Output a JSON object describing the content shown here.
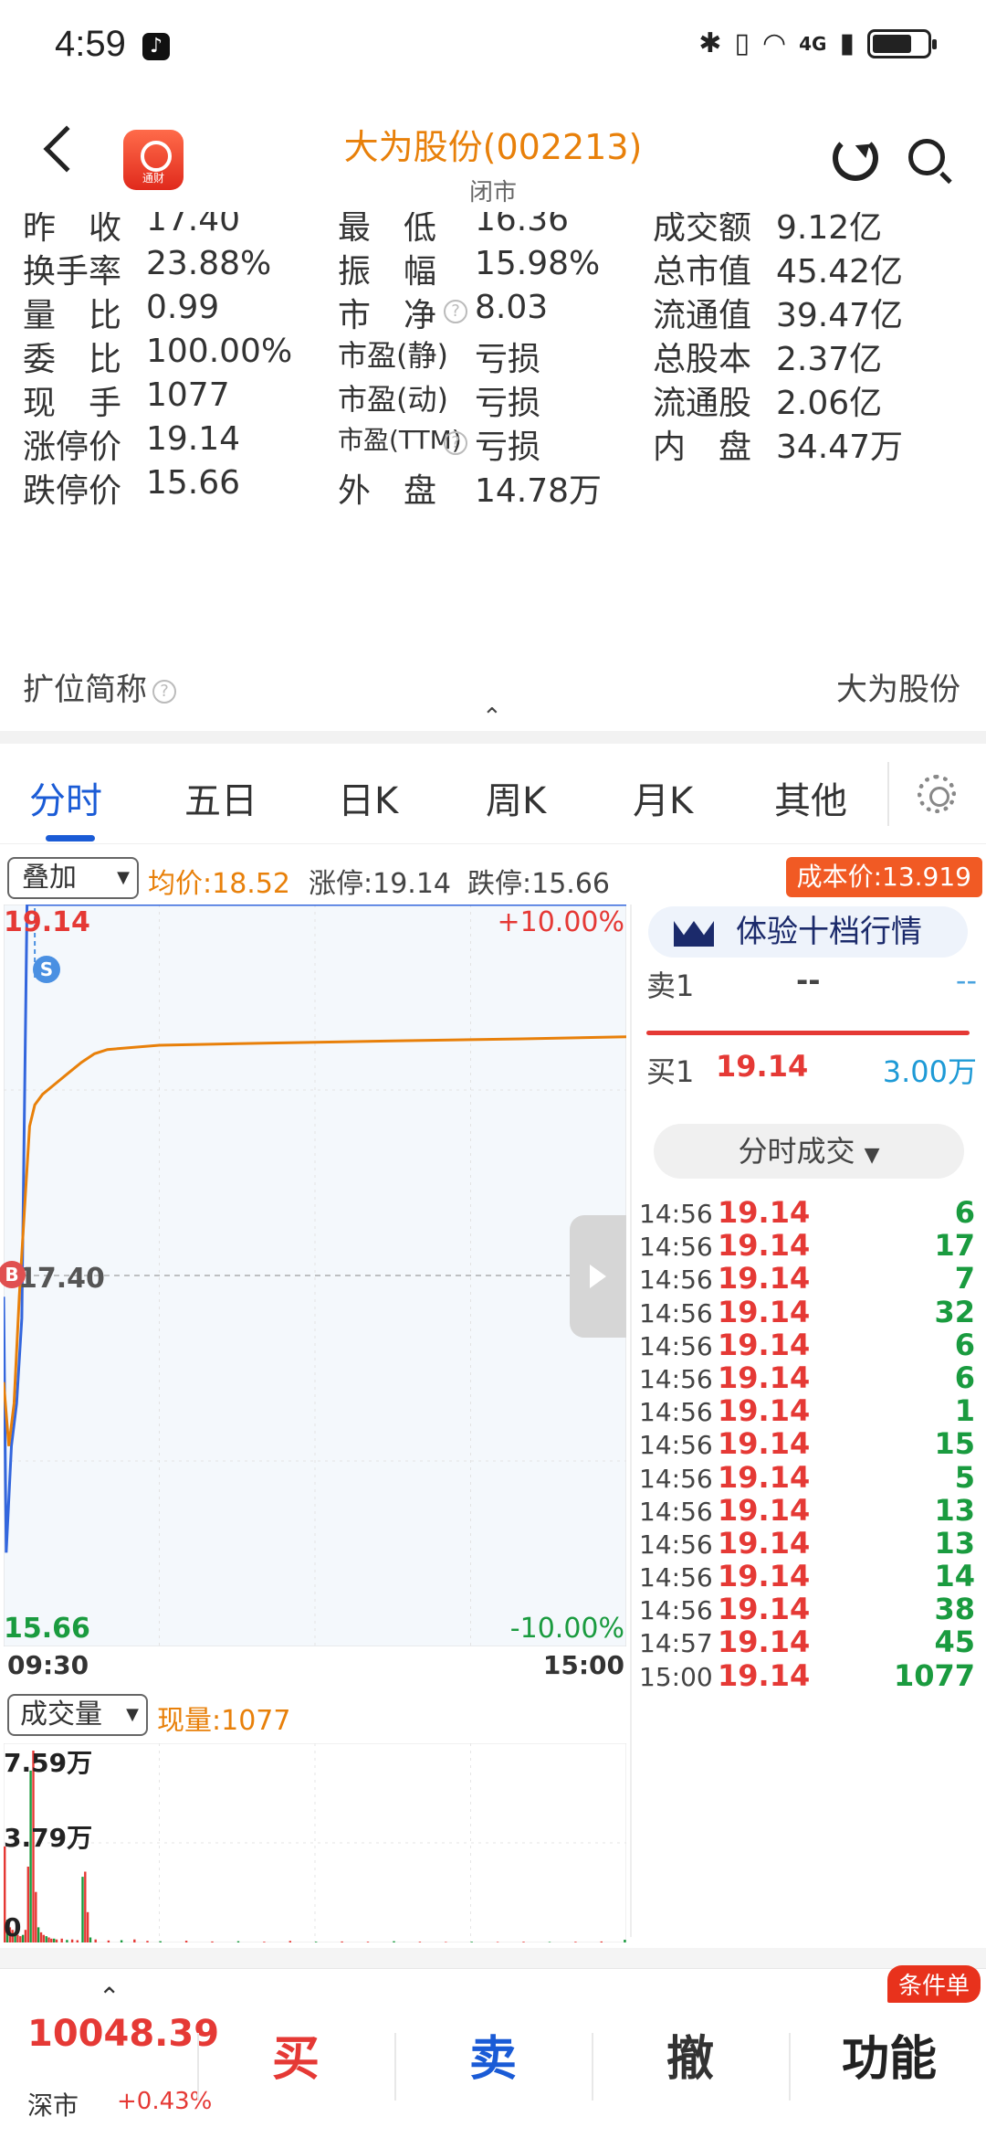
{
  "status_bar": {
    "time": "4:59",
    "network": "4G"
  },
  "header": {
    "title": "大为股份(002213)",
    "subtitle": "闭市",
    "app_logo_text": "通财"
  },
  "quote": {
    "rows": [
      [
        {
          "label": "昨　收",
          "value": "17.40",
          "color": "#333333"
        },
        {
          "label": "最　低",
          "value": "16.36",
          "color": "#333333"
        },
        {
          "label": "成交额",
          "value": "9.12亿",
          "color": "#333333"
        }
      ],
      [
        {
          "label": "换手率",
          "value": "23.88%",
          "color": "#333333"
        },
        {
          "label": "振　幅",
          "value": "15.98%",
          "color": "#333333"
        },
        {
          "label": "总市值",
          "value": "45.42亿",
          "color": "#333333"
        }
      ],
      [
        {
          "label": "量　比",
          "value": "0.99",
          "color": "#333333"
        },
        {
          "label": "市　净",
          "value": "8.03",
          "color": "#333333"
        },
        {
          "label": "流通值",
          "value": "39.47亿",
          "color": "#333333"
        }
      ],
      [
        {
          "label": "委　比",
          "value": "100.00%",
          "color": "#333333"
        },
        {
          "label": "市盈(静)",
          "value": "亏损",
          "color": "#333333"
        },
        {
          "label": "总股本",
          "value": "2.37亿",
          "color": "#333333"
        }
      ],
      [
        {
          "label": "现　手",
          "value": "1077",
          "color": "#333333"
        },
        {
          "label": "市盈(动)",
          "value": "亏损",
          "color": "#333333"
        },
        {
          "label": "流通股",
          "value": "2.06亿",
          "color": "#333333"
        }
      ],
      [
        {
          "label": "涨停价",
          "value": "19.14",
          "color": "#333333"
        },
        {
          "label": "市盈(TTM)",
          "value": "亏损",
          "color": "#333333"
        },
        {
          "label": "内　盘",
          "value": "34.47万",
          "color": "#333333"
        }
      ],
      [
        {
          "label": "跌停价",
          "value": "15.66",
          "color": "#333333"
        },
        {
          "label": "外　盘",
          "value": "14.78万",
          "color": "#333333"
        },
        null
      ]
    ],
    "expand_label": "扩位简称",
    "expand_value": "大为股份"
  },
  "tabs": [
    "分时",
    "五日",
    "日K",
    "周K",
    "月K",
    "其他"
  ],
  "active_tab": 0,
  "chart_info": {
    "overlay_label": "叠加",
    "avg_price": "均价:18.52",
    "limit_up": "涨停:19.14",
    "limit_down": "跌停:15.66",
    "cost_price": "成本价:13.919"
  },
  "chart_data": {
    "type": "line",
    "y_max_label": "19.14",
    "y_mid_label": "17.40",
    "y_min_label": "15.66",
    "pct_top_label": "+10.00%",
    "pct_bottom_label": "-10.00%",
    "x_start": "09:30",
    "x_end": "15:00",
    "ylim": [
      15.66,
      19.14
    ],
    "series": [
      {
        "color": "#3366dd",
        "x_minutes": [
          0,
          1,
          3,
          5,
          7,
          9,
          12,
          15,
          18,
          20,
          240
        ],
        "values": [
          17.3,
          16.1,
          16.6,
          16.8,
          17.2,
          19.14,
          19.14,
          19.14,
          19.14,
          19.14,
          19.14
        ]
      },
      {
        "color": "#e8800a",
        "x_minutes": [
          0,
          2,
          4,
          6,
          8,
          10,
          12,
          15,
          20,
          25,
          30,
          35,
          40,
          60,
          100,
          150,
          200,
          240
        ],
        "values": [
          16.9,
          16.6,
          16.8,
          17.3,
          17.7,
          18.1,
          18.2,
          18.25,
          18.3,
          18.35,
          18.4,
          18.44,
          18.46,
          18.48,
          18.49,
          18.5,
          18.51,
          18.52
        ]
      }
    ],
    "markers": [
      {
        "label": "B",
        "color": "#e05050"
      },
      {
        "label": "S",
        "color": "#4a90e2"
      }
    ],
    "volume": {
      "selector_label": "成交量",
      "current": "现量:1077",
      "max_label": "7.59万",
      "mid_label": "3.79万",
      "zero_label": "0",
      "ylim": [
        0,
        75900
      ],
      "bars": [
        {
          "x_minutes": 0,
          "v": 38000
        },
        {
          "x_minutes": 1,
          "v": 9000
        },
        {
          "x_minutes": 2,
          "v": 6000
        },
        {
          "x_minutes": 3,
          "v": 5000
        },
        {
          "x_minutes": 4,
          "v": 4000
        },
        {
          "x_minutes": 5,
          "v": 3000
        },
        {
          "x_minutes": 6,
          "v": 2500
        },
        {
          "x_minutes": 7,
          "v": 3000
        },
        {
          "x_minutes": 8,
          "v": 5000
        },
        {
          "x_minutes": 9,
          "v": 30000
        },
        {
          "x_minutes": 10,
          "v": 68000
        },
        {
          "x_minutes": 11,
          "v": 75900
        },
        {
          "x_minutes": 12,
          "v": 20000
        },
        {
          "x_minutes": 13,
          "v": 6000
        },
        {
          "x_minutes": 14,
          "v": 4000
        },
        {
          "x_minutes": 15,
          "v": 3000
        },
        {
          "x_minutes": 16,
          "v": 2500
        },
        {
          "x_minutes": 17,
          "v": 2000
        },
        {
          "x_minutes": 18,
          "v": 1500
        },
        {
          "x_minutes": 19,
          "v": 1500
        },
        {
          "x_minutes": 20,
          "v": 1200
        },
        {
          "x_minutes": 22,
          "v": 1500
        },
        {
          "x_minutes": 24,
          "v": 1000
        },
        {
          "x_minutes": 26,
          "v": 1200
        },
        {
          "x_minutes": 28,
          "v": 900
        },
        {
          "x_minutes": 30,
          "v": 26000
        },
        {
          "x_minutes": 31,
          "v": 28000
        },
        {
          "x_minutes": 32,
          "v": 12000
        },
        {
          "x_minutes": 33,
          "v": 2000
        },
        {
          "x_minutes": 35,
          "v": 1200
        },
        {
          "x_minutes": 40,
          "v": 800
        },
        {
          "x_minutes": 45,
          "v": 900
        },
        {
          "x_minutes": 50,
          "v": 1200
        },
        {
          "x_minutes": 55,
          "v": 600
        },
        {
          "x_minutes": 60,
          "v": 500
        },
        {
          "x_minutes": 70,
          "v": 700
        },
        {
          "x_minutes": 80,
          "v": 400
        },
        {
          "x_minutes": 90,
          "v": 500
        },
        {
          "x_minutes": 100,
          "v": 300
        },
        {
          "x_minutes": 110,
          "v": 600
        },
        {
          "x_minutes": 120,
          "v": 300
        },
        {
          "x_minutes": 130,
          "v": 400
        },
        {
          "x_minutes": 140,
          "v": 300
        },
        {
          "x_minutes": 150,
          "v": 500
        },
        {
          "x_minutes": 160,
          "v": 300
        },
        {
          "x_minutes": 170,
          "v": 200
        },
        {
          "x_minutes": 180,
          "v": 300
        },
        {
          "x_minutes": 190,
          "v": 200
        },
        {
          "x_minutes": 200,
          "v": 300
        },
        {
          "x_minutes": 210,
          "v": 200
        },
        {
          "x_minutes": 220,
          "v": 300
        },
        {
          "x_minutes": 230,
          "v": 400
        },
        {
          "x_minutes": 239,
          "v": 1077
        }
      ]
    }
  },
  "order_book": {
    "level2_button": "体验十档行情",
    "sell1": {
      "label": "卖1",
      "price": "--",
      "volume": "--"
    },
    "buy1": {
      "label": "买1",
      "price": "19.14",
      "volume": "3.00万"
    }
  },
  "ticks": {
    "selector_label": "分时成交",
    "rows": [
      {
        "time": "14:56",
        "price": "19.14",
        "vol": "6"
      },
      {
        "time": "14:56",
        "price": "19.14",
        "vol": "17"
      },
      {
        "time": "14:56",
        "price": "19.14",
        "vol": "7"
      },
      {
        "time": "14:56",
        "price": "19.14",
        "vol": "32"
      },
      {
        "time": "14:56",
        "price": "19.14",
        "vol": "6"
      },
      {
        "time": "14:56",
        "price": "19.14",
        "vol": "6"
      },
      {
        "time": "14:56",
        "price": "19.14",
        "vol": "1"
      },
      {
        "time": "14:56",
        "price": "19.14",
        "vol": "15"
      },
      {
        "time": "14:56",
        "price": "19.14",
        "vol": "5"
      },
      {
        "time": "14:56",
        "price": "19.14",
        "vol": "13"
      },
      {
        "time": "14:56",
        "price": "19.14",
        "vol": "13"
      },
      {
        "time": "14:56",
        "price": "19.14",
        "vol": "14"
      },
      {
        "time": "14:56",
        "price": "19.14",
        "vol": "38"
      },
      {
        "time": "14:57",
        "price": "19.14",
        "vol": "45"
      },
      {
        "time": "15:00",
        "price": "19.14",
        "vol": "1077"
      }
    ]
  },
  "bottom_bar": {
    "index_value": "10048.39",
    "market": "深市",
    "change": "+0.43%",
    "buy": "买",
    "sell": "卖",
    "cancel": "撤",
    "function": "功能",
    "cond_badge": "条件单"
  },
  "colors": {
    "up": "#e53935",
    "down": "#1a9b3f",
    "accent": "#1a5bd6",
    "avg": "#e8800a"
  }
}
